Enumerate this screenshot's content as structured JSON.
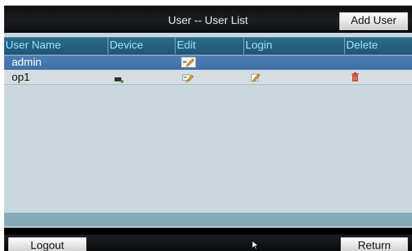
{
  "window": {
    "title": "User -- User List"
  },
  "toolbar": {
    "add_user_label": "Add User"
  },
  "table": {
    "columns": [
      "User Name",
      "Device",
      "Edit",
      "Login",
      "Delete"
    ],
    "rows": [
      {
        "user_name": "admin",
        "selected": true
      },
      {
        "user_name": "op1",
        "selected": false
      }
    ]
  },
  "bottom": {
    "logout_label": "Logout",
    "return_label": "Return"
  },
  "icons": {
    "device": "device-icon",
    "edit": "edit-icon",
    "login": "pencil-icon",
    "delete": "trash-icon",
    "cursor": "mouse-pointer-icon"
  },
  "colors": {
    "header": "#1f5777",
    "header_text": "#9fe0ff",
    "selected_row": "#4477ad",
    "grid_bg": "#c9d7df",
    "delete_icon": "#c0392b"
  }
}
